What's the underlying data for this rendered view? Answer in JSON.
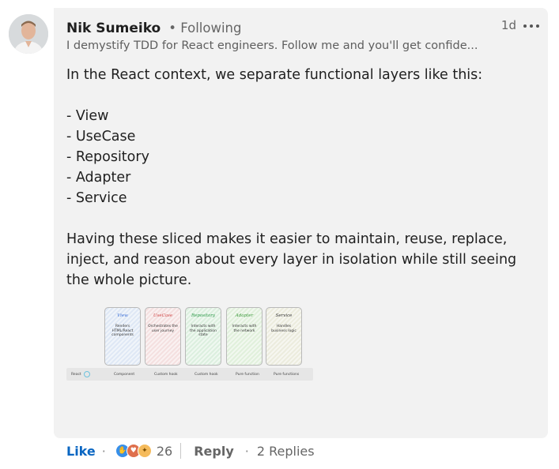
{
  "author": {
    "name": "Nik Sumeiko",
    "follow_status": "• Following",
    "headline": "I demystify TDD for React engineers. Follow me and you'll get confide...",
    "avatar_icon": "profile-photo"
  },
  "timestamp": "1d",
  "more_icon": "ellipsis-icon",
  "body": {
    "intro": "In the React context, we separate functional layers like this:",
    "layers": [
      "- View",
      "- UseCase",
      "- Repository",
      "- Adapter",
      "- Service"
    ],
    "outro": "Having these sliced makes it easier to maintain, reuse, replace, inject, and reason about every layer in isolation while still seeing the whole picture."
  },
  "figure": {
    "cards": [
      {
        "title": "View",
        "desc": "Renders HTML/React components",
        "color": "#3b6fd6",
        "fill": "#dfe8f5",
        "footer": "Component"
      },
      {
        "title": "UseCase",
        "desc": "Orchestrates the user journey",
        "color": "#d04848",
        "fill": "#f4e0e0",
        "footer": "Custom hook"
      },
      {
        "title": "Repository",
        "desc": "Interacts with the application state",
        "color": "#2e9a4a",
        "fill": "#dcefdf",
        "footer": "Custom hook"
      },
      {
        "title": "Adapter",
        "desc": "Interacts with the network",
        "color": "#3d9a3d",
        "fill": "#e1f0dc",
        "footer": "Pure function"
      },
      {
        "title": "Service",
        "desc": "Handles business logic",
        "color": "#333333",
        "fill": "#ececde",
        "footer": "Pure functions"
      }
    ],
    "row_label": "React"
  },
  "actions": {
    "like": "Like",
    "reaction_count": "26",
    "reply": "Reply",
    "replies": "2 Replies"
  }
}
